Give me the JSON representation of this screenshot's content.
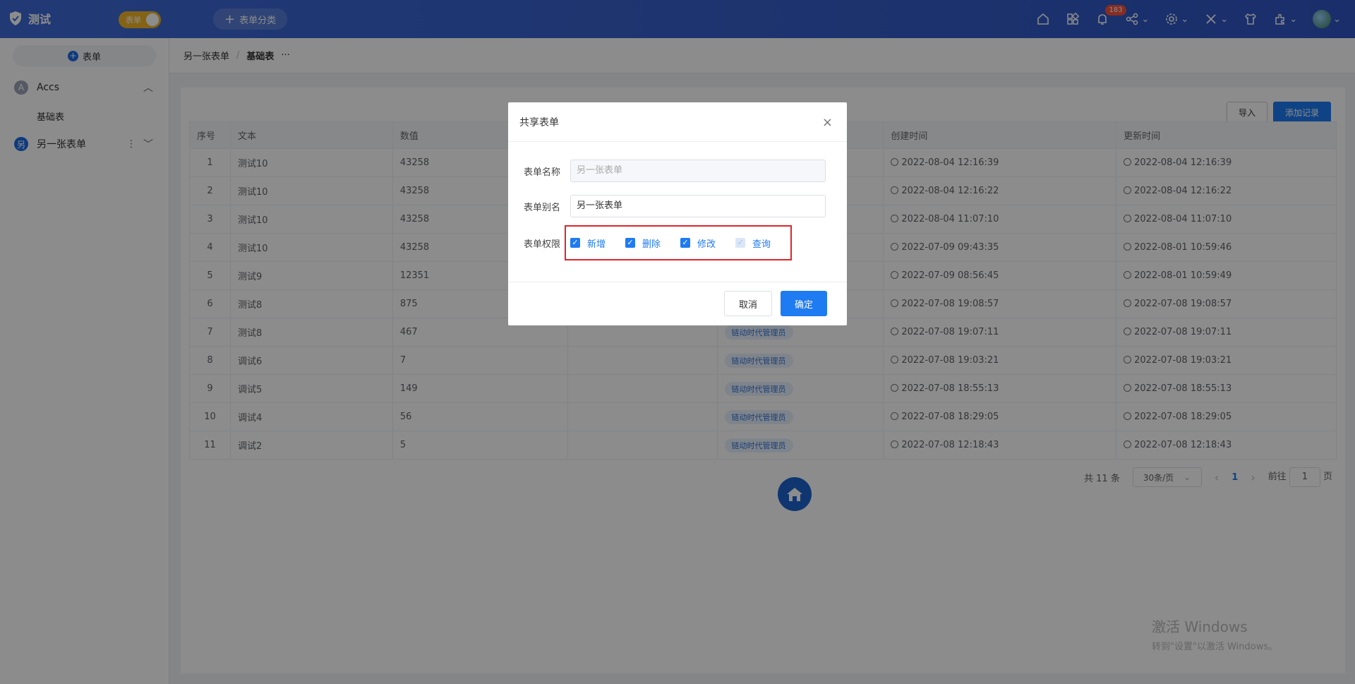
{
  "topbar": {
    "app_name": "测试",
    "toggle_label": "表单",
    "category_button": "表单分类",
    "notification_count": "183"
  },
  "sidebar": {
    "new_button": "表单",
    "groups": [
      {
        "letter": "A",
        "label": "Accs",
        "color": "#9aa3b5"
      },
      {
        "letter": "另",
        "label": "另一张表单",
        "color": "#1d6ae6"
      }
    ],
    "sub_item": "基础表"
  },
  "breadcrumb": {
    "parent": "另一张表单",
    "separator": "/",
    "current": "基础表",
    "more": "···"
  },
  "toolbar": {
    "import": "导入",
    "add_record": "添加记录"
  },
  "table": {
    "headers": [
      "序号",
      "文本",
      "数值",
      "",
      "",
      "创建时间",
      "更新时间"
    ],
    "rows": [
      [
        "1",
        "测试10",
        "43258",
        "",
        "",
        "2022-08-04 12:16:39",
        "2022-08-04 12:16:39"
      ],
      [
        "2",
        "测试10",
        "43258",
        "",
        "",
        "2022-08-04 12:16:22",
        "2022-08-04 12:16:22"
      ],
      [
        "3",
        "测试10",
        "43258",
        "",
        "",
        "2022-08-04 11:07:10",
        "2022-08-04 11:07:10"
      ],
      [
        "4",
        "测试10",
        "43258",
        "",
        "",
        "2022-07-09 09:43:35",
        "2022-08-01 10:59:46"
      ],
      [
        "5",
        "测试9",
        "12351",
        "",
        "",
        "2022-07-09 08:56:45",
        "2022-08-01 10:59:49"
      ],
      [
        "6",
        "测试8",
        "875",
        "",
        "",
        "2022-07-08 19:08:57",
        "2022-07-08 19:08:57"
      ],
      [
        "7",
        "测试8",
        "467",
        "",
        "链动时代管理员",
        "2022-07-08 19:07:11",
        "2022-07-08 19:07:11"
      ],
      [
        "8",
        "调试6",
        "7",
        "",
        "链动时代管理员",
        "2022-07-08 19:03:21",
        "2022-07-08 19:03:21"
      ],
      [
        "9",
        "调试5",
        "149",
        "",
        "链动时代管理员",
        "2022-07-08 18:55:13",
        "2022-07-08 18:55:13"
      ],
      [
        "10",
        "调试4",
        "56",
        "",
        "链动时代管理员",
        "2022-07-08 18:29:05",
        "2022-07-08 18:29:05"
      ],
      [
        "11",
        "调试2",
        "5",
        "",
        "链动时代管理员",
        "2022-07-08 12:18:43",
        "2022-07-08 12:18:43"
      ]
    ]
  },
  "pagination": {
    "total": "共 11 条",
    "page_size": "30条/页",
    "prev": "‹",
    "current_page": "1",
    "next": "›",
    "goto_label": "前往",
    "goto_value": "1",
    "goto_suffix": "页"
  },
  "watermark": {
    "title": "激活 Windows",
    "subtitle": "转到\"设置\"以激活 Windows。"
  },
  "modal": {
    "title": "共享表单",
    "close": "×",
    "name_label": "表单名称",
    "name_placeholder": "另一张表单",
    "alias_label": "表单别名",
    "alias_value": "另一张表单",
    "perm_label": "表单权限",
    "perms": [
      {
        "label": "新增",
        "checked": true
      },
      {
        "label": "删除",
        "checked": true
      },
      {
        "label": "修改",
        "checked": true
      },
      {
        "label": "查询",
        "checked": true,
        "disabled": true
      }
    ],
    "cancel": "取消",
    "confirm": "确定"
  }
}
